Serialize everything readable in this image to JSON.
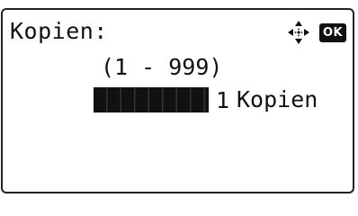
{
  "screen": {
    "title": "Kopien:",
    "ok_label": "OK",
    "icons": [
      "four-way-nav-icon",
      "ok-key-icon"
    ]
  },
  "quantity": {
    "range_text": "(1 - 999)",
    "value": "1",
    "unit": "Kopien",
    "min": 1,
    "max": 999
  },
  "colors": {
    "foreground": "#111111",
    "background": "#ffffff"
  }
}
